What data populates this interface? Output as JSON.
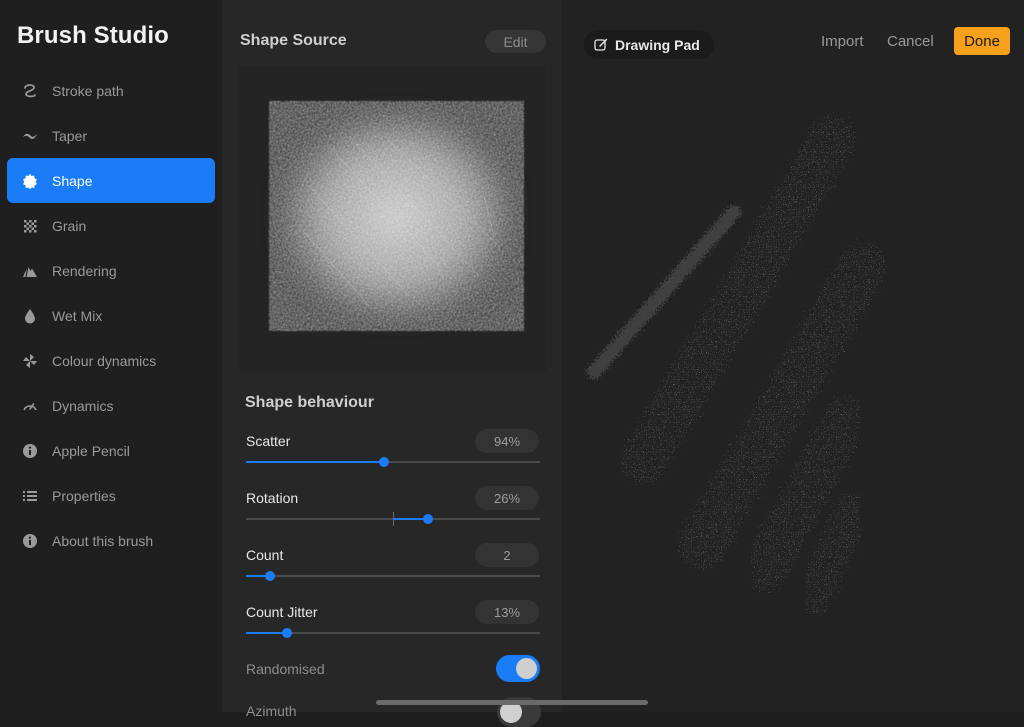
{
  "app": {
    "title": "Brush Studio"
  },
  "sidebar": {
    "items": [
      {
        "label": "Stroke path",
        "icon": "stroke-path-icon"
      },
      {
        "label": "Taper",
        "icon": "taper-icon"
      },
      {
        "label": "Shape",
        "icon": "shape-icon",
        "active": true
      },
      {
        "label": "Grain",
        "icon": "grain-icon"
      },
      {
        "label": "Rendering",
        "icon": "rendering-icon"
      },
      {
        "label": "Wet Mix",
        "icon": "wet-mix-icon"
      },
      {
        "label": "Colour dynamics",
        "icon": "colour-dynamics-icon"
      },
      {
        "label": "Dynamics",
        "icon": "dynamics-icon"
      },
      {
        "label": "Apple Pencil",
        "icon": "apple-pencil-icon"
      },
      {
        "label": "Properties",
        "icon": "properties-icon"
      },
      {
        "label": "About this brush",
        "icon": "info-icon"
      }
    ]
  },
  "shape_source": {
    "title": "Shape Source",
    "edit_label": "Edit"
  },
  "behaviour": {
    "title": "Shape behaviour",
    "params": [
      {
        "label": "Scatter",
        "value": "94%",
        "level": 0.47
      },
      {
        "label": "Rotation",
        "value": "26%",
        "level": 0.62,
        "centered": true
      },
      {
        "label": "Count",
        "value": "2",
        "level": 0.08
      },
      {
        "label": "Count Jitter",
        "value": "13%",
        "level": 0.14
      }
    ],
    "randomised": {
      "label": "Randomised",
      "on": true
    },
    "next_label": "Azimuth"
  },
  "pad": {
    "title": "Drawing Pad",
    "import_label": "Import",
    "cancel_label": "Cancel",
    "done_label": "Done"
  },
  "colors": {
    "accent": "#1a7df7",
    "done": "#f7a01b",
    "background": "#1e1e1e"
  }
}
